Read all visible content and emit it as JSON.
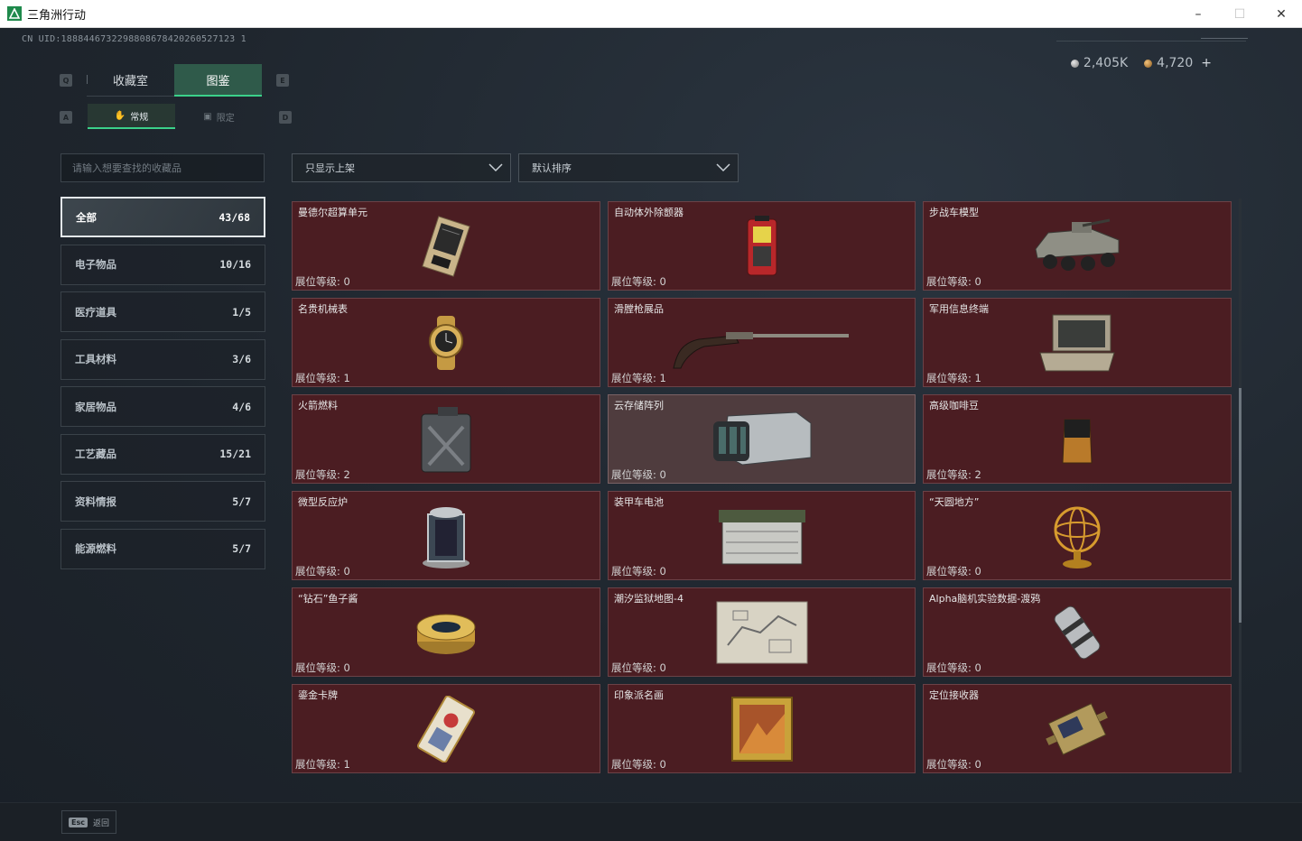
{
  "window": {
    "title": "三角洲行动",
    "minimize": "–",
    "maximize": "☐",
    "close": "✕"
  },
  "header": {
    "uid": "CN UID:1888446732298808678420260527123 1",
    "currency": [
      {
        "icon": "silver-coin-icon",
        "value": "2,405K"
      },
      {
        "icon": "gold-coin-icon",
        "value": "4,720"
      }
    ],
    "add_label": "+"
  },
  "keys": {
    "prev_tab": "Q",
    "next_tab": "E",
    "prev_sub": "A",
    "next_sub": "D"
  },
  "main_tabs": [
    {
      "label": "收藏室",
      "active": false
    },
    {
      "label": "图鉴",
      "active": true
    }
  ],
  "sub_tabs": [
    {
      "label": "常规",
      "icon": "hand-icon",
      "active": true
    },
    {
      "label": "限定",
      "icon": "frame-icon",
      "active": false
    }
  ],
  "search": {
    "placeholder": "请输入想要查找的收藏品",
    "value": ""
  },
  "categories": [
    {
      "name": "全部",
      "count": "43/68",
      "active": true
    },
    {
      "name": "电子物品",
      "count": "10/16",
      "active": false
    },
    {
      "name": "医疗道具",
      "count": "1/5",
      "active": false
    },
    {
      "name": "工具材料",
      "count": "3/6",
      "active": false
    },
    {
      "name": "家居物品",
      "count": "4/6",
      "active": false
    },
    {
      "name": "工艺藏品",
      "count": "15/21",
      "active": false
    },
    {
      "name": "资料情报",
      "count": "5/7",
      "active": false
    },
    {
      "name": "能源燃料",
      "count": "5/7",
      "active": false
    }
  ],
  "filters": {
    "shelf_filter": "只显示上架",
    "sort": "默认排序"
  },
  "level_label": "展位等级:",
  "items": [
    {
      "name": "曼德尔超算单元",
      "level": "0",
      "icon": "supercomputer-unit-icon"
    },
    {
      "name": "自动体外除颤器",
      "level": "0",
      "icon": "defibrillator-icon"
    },
    {
      "name": "步战车模型",
      "level": "0",
      "icon": "ifv-model-icon"
    },
    {
      "name": "名贵机械表",
      "level": "1",
      "icon": "watch-icon"
    },
    {
      "name": "滑膛枪展品",
      "level": "1",
      "icon": "musket-icon"
    },
    {
      "name": "军用信息终端",
      "level": "1",
      "icon": "military-terminal-icon"
    },
    {
      "name": "火箭燃料",
      "level": "2",
      "icon": "fuel-can-icon"
    },
    {
      "name": "云存储阵列",
      "level": "0",
      "icon": "storage-array-icon",
      "selected": true
    },
    {
      "name": "高级咖啡豆",
      "level": "2",
      "icon": "coffee-beans-icon"
    },
    {
      "name": "微型反应炉",
      "level": "0",
      "icon": "mini-reactor-icon"
    },
    {
      "name": "装甲车电池",
      "level": "0",
      "icon": "vehicle-battery-icon"
    },
    {
      "name": "“天圆地方”",
      "level": "0",
      "icon": "armillary-sphere-icon"
    },
    {
      "name": "“钻石”鱼子酱",
      "level": "0",
      "icon": "caviar-tin-icon"
    },
    {
      "name": "潮汐监狱地图-4",
      "level": "0",
      "icon": "prison-map-icon"
    },
    {
      "name": "Alpha脑机实验数据-渡鸦",
      "level": "0",
      "icon": "data-capsule-icon"
    },
    {
      "name": "鎏金卡牌",
      "level": "1",
      "icon": "gilded-card-icon"
    },
    {
      "name": "印象派名画",
      "level": "0",
      "icon": "framed-painting-icon"
    },
    {
      "name": "定位接收器",
      "level": "0",
      "icon": "locator-receiver-icon"
    }
  ],
  "footer": {
    "esc_key": "Esc",
    "esc_label": "返回"
  }
}
